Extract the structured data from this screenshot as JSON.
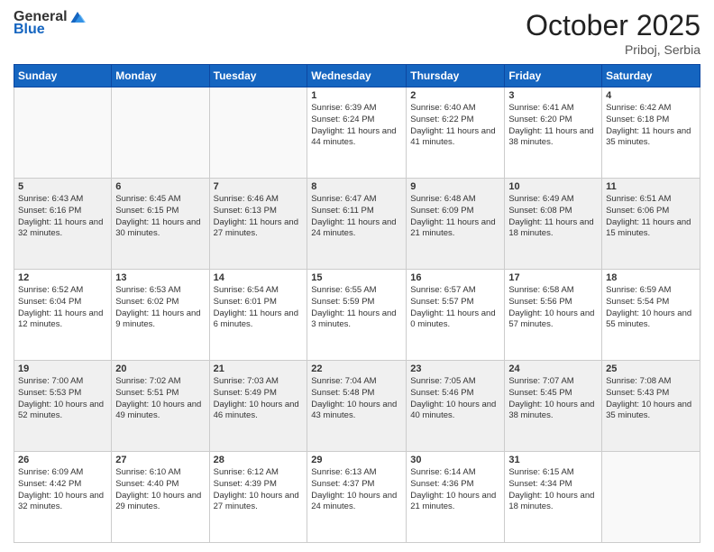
{
  "header": {
    "logo_general": "General",
    "logo_blue": "Blue",
    "title": "October 2025",
    "location": "Priboj, Serbia"
  },
  "days_of_week": [
    "Sunday",
    "Monday",
    "Tuesday",
    "Wednesday",
    "Thursday",
    "Friday",
    "Saturday"
  ],
  "weeks": [
    [
      {
        "day": "",
        "info": ""
      },
      {
        "day": "",
        "info": ""
      },
      {
        "day": "",
        "info": ""
      },
      {
        "day": "1",
        "info": "Sunrise: 6:39 AM\nSunset: 6:24 PM\nDaylight: 11 hours and 44 minutes."
      },
      {
        "day": "2",
        "info": "Sunrise: 6:40 AM\nSunset: 6:22 PM\nDaylight: 11 hours and 41 minutes."
      },
      {
        "day": "3",
        "info": "Sunrise: 6:41 AM\nSunset: 6:20 PM\nDaylight: 11 hours and 38 minutes."
      },
      {
        "day": "4",
        "info": "Sunrise: 6:42 AM\nSunset: 6:18 PM\nDaylight: 11 hours and 35 minutes."
      }
    ],
    [
      {
        "day": "5",
        "info": "Sunrise: 6:43 AM\nSunset: 6:16 PM\nDaylight: 11 hours and 32 minutes."
      },
      {
        "day": "6",
        "info": "Sunrise: 6:45 AM\nSunset: 6:15 PM\nDaylight: 11 hours and 30 minutes."
      },
      {
        "day": "7",
        "info": "Sunrise: 6:46 AM\nSunset: 6:13 PM\nDaylight: 11 hours and 27 minutes."
      },
      {
        "day": "8",
        "info": "Sunrise: 6:47 AM\nSunset: 6:11 PM\nDaylight: 11 hours and 24 minutes."
      },
      {
        "day": "9",
        "info": "Sunrise: 6:48 AM\nSunset: 6:09 PM\nDaylight: 11 hours and 21 minutes."
      },
      {
        "day": "10",
        "info": "Sunrise: 6:49 AM\nSunset: 6:08 PM\nDaylight: 11 hours and 18 minutes."
      },
      {
        "day": "11",
        "info": "Sunrise: 6:51 AM\nSunset: 6:06 PM\nDaylight: 11 hours and 15 minutes."
      }
    ],
    [
      {
        "day": "12",
        "info": "Sunrise: 6:52 AM\nSunset: 6:04 PM\nDaylight: 11 hours and 12 minutes."
      },
      {
        "day": "13",
        "info": "Sunrise: 6:53 AM\nSunset: 6:02 PM\nDaylight: 11 hours and 9 minutes."
      },
      {
        "day": "14",
        "info": "Sunrise: 6:54 AM\nSunset: 6:01 PM\nDaylight: 11 hours and 6 minutes."
      },
      {
        "day": "15",
        "info": "Sunrise: 6:55 AM\nSunset: 5:59 PM\nDaylight: 11 hours and 3 minutes."
      },
      {
        "day": "16",
        "info": "Sunrise: 6:57 AM\nSunset: 5:57 PM\nDaylight: 11 hours and 0 minutes."
      },
      {
        "day": "17",
        "info": "Sunrise: 6:58 AM\nSunset: 5:56 PM\nDaylight: 10 hours and 57 minutes."
      },
      {
        "day": "18",
        "info": "Sunrise: 6:59 AM\nSunset: 5:54 PM\nDaylight: 10 hours and 55 minutes."
      }
    ],
    [
      {
        "day": "19",
        "info": "Sunrise: 7:00 AM\nSunset: 5:53 PM\nDaylight: 10 hours and 52 minutes."
      },
      {
        "day": "20",
        "info": "Sunrise: 7:02 AM\nSunset: 5:51 PM\nDaylight: 10 hours and 49 minutes."
      },
      {
        "day": "21",
        "info": "Sunrise: 7:03 AM\nSunset: 5:49 PM\nDaylight: 10 hours and 46 minutes."
      },
      {
        "day": "22",
        "info": "Sunrise: 7:04 AM\nSunset: 5:48 PM\nDaylight: 10 hours and 43 minutes."
      },
      {
        "day": "23",
        "info": "Sunrise: 7:05 AM\nSunset: 5:46 PM\nDaylight: 10 hours and 40 minutes."
      },
      {
        "day": "24",
        "info": "Sunrise: 7:07 AM\nSunset: 5:45 PM\nDaylight: 10 hours and 38 minutes."
      },
      {
        "day": "25",
        "info": "Sunrise: 7:08 AM\nSunset: 5:43 PM\nDaylight: 10 hours and 35 minutes."
      }
    ],
    [
      {
        "day": "26",
        "info": "Sunrise: 6:09 AM\nSunset: 4:42 PM\nDaylight: 10 hours and 32 minutes."
      },
      {
        "day": "27",
        "info": "Sunrise: 6:10 AM\nSunset: 4:40 PM\nDaylight: 10 hours and 29 minutes."
      },
      {
        "day": "28",
        "info": "Sunrise: 6:12 AM\nSunset: 4:39 PM\nDaylight: 10 hours and 27 minutes."
      },
      {
        "day": "29",
        "info": "Sunrise: 6:13 AM\nSunset: 4:37 PM\nDaylight: 10 hours and 24 minutes."
      },
      {
        "day": "30",
        "info": "Sunrise: 6:14 AM\nSunset: 4:36 PM\nDaylight: 10 hours and 21 minutes."
      },
      {
        "day": "31",
        "info": "Sunrise: 6:15 AM\nSunset: 4:34 PM\nDaylight: 10 hours and 18 minutes."
      },
      {
        "day": "",
        "info": ""
      }
    ]
  ]
}
